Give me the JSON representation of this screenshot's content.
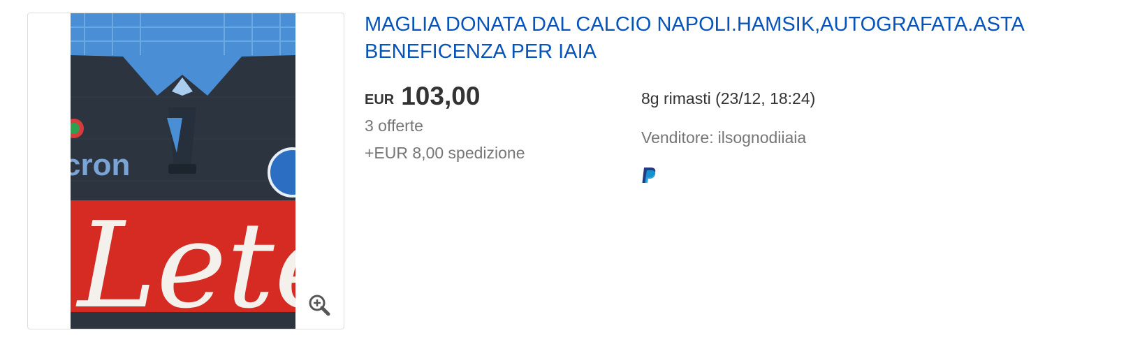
{
  "listing": {
    "title": "MAGLIA DONATA DAL CALCIO NAPOLI.HAMSIK,AUTOGRAFATA.ASTA BENEFICENZA PER IAIA",
    "price": {
      "currency": "EUR",
      "amount": "103,00"
    },
    "bids": "3 offerte",
    "shipping": "+EUR 8,00 spedizione",
    "time_left": "8g rimasti (23/12, 18:24)",
    "seller": {
      "label": "Venditore:",
      "name": "ilsognodiiaia"
    },
    "thumbnail": {
      "alt": "Maglia Napoli Lete",
      "sponsor_text": "Lete",
      "brand_text": "cron"
    },
    "icons": {
      "zoom": "zoom-in-icon",
      "payment": "paypal-icon"
    },
    "colors": {
      "title_link": "#0654ba",
      "price": "#333333",
      "secondary": "#767676",
      "border": "#dddddd"
    }
  }
}
